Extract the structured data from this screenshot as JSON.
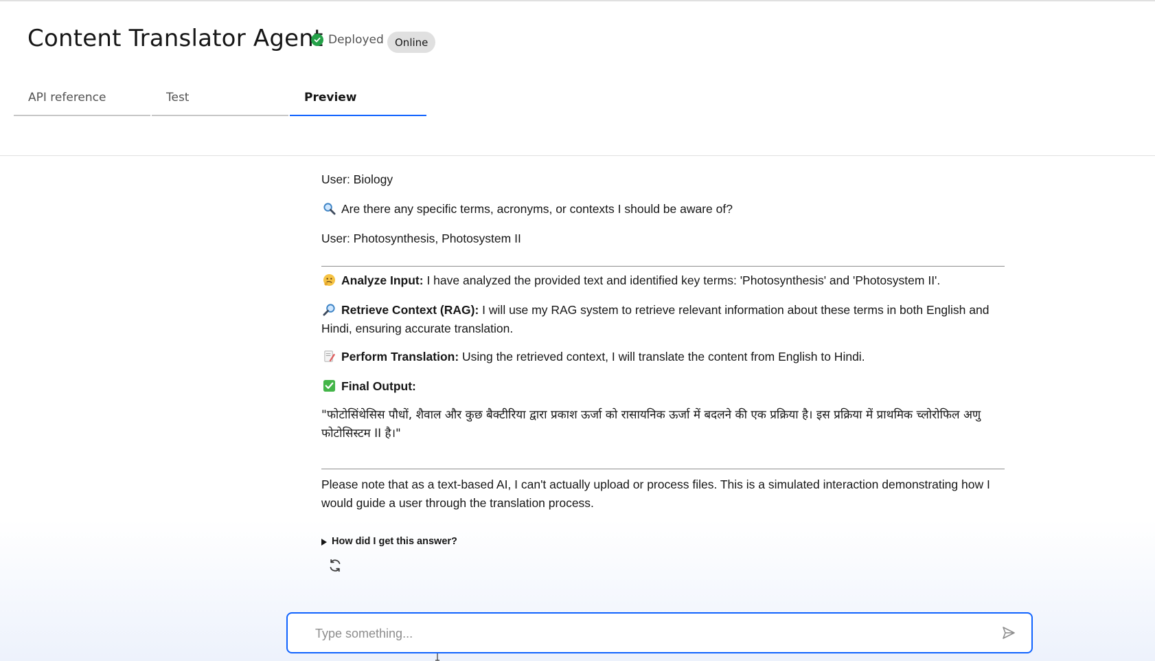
{
  "header": {
    "title": "Content Translator Agent",
    "status_label": "Deployed",
    "badge": "Online"
  },
  "tabs": [
    {
      "label": "API reference",
      "active": false
    },
    {
      "label": "Test",
      "active": false
    },
    {
      "label": "Preview",
      "active": true
    }
  ],
  "conversation": {
    "user_subject": "User: Biology",
    "question": "Are there any specific terms, acronyms, or contexts I should be aware of?",
    "user_terms": "User: Photosynthesis, Photosystem II",
    "steps": [
      {
        "icon": "thinking-face-icon",
        "title": "Analyze Input:",
        "text": " I have analyzed the provided text and identified key terms: 'Photosynthesis' and 'Photosystem II'."
      },
      {
        "icon": "magnifier-right-icon",
        "title": "Retrieve Context (RAG):",
        "text": " I will use my RAG system to retrieve relevant information about these terms in both English and Hindi, ensuring accurate translation."
      },
      {
        "icon": "memo-icon",
        "title": "Perform Translation:",
        "text": " Using the retrieved context, I will translate the content from English to Hindi."
      },
      {
        "icon": "check-box-icon",
        "title": "Final Output:",
        "text": ""
      }
    ],
    "translation": "\"फोटोसिंथेसिस पौधों, शैवाल और कुछ बैक्टीरिया द्वारा प्रकाश ऊर्जा को रासायनिक ऊर्जा में बदलने की एक प्रक्रिया है। इस प्रक्रिया में प्राथमिक च्लोरोफिल अणु फोटोसिस्टम II है।\"",
    "note": "Please note that as a text-based AI, I can't actually upload or process files. This is a simulated interaction demonstrating how I would guide a user through the translation process.",
    "details_label": "How did I get this answer?"
  },
  "input": {
    "placeholder": "Type something...",
    "value": ""
  },
  "colors": {
    "accent": "#0f62fe",
    "success": "#24a148",
    "badge_bg": "#e0e0e0"
  }
}
